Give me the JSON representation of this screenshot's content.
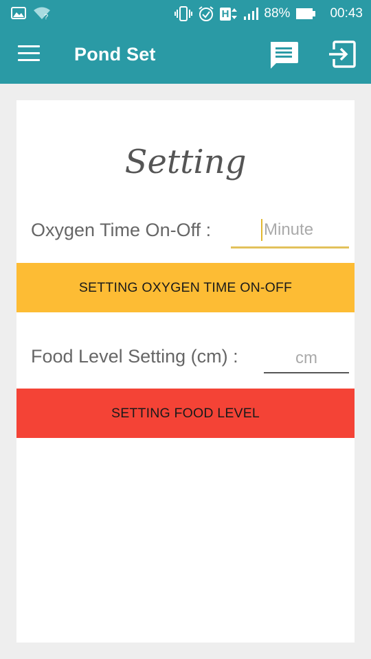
{
  "status_bar": {
    "battery": "88%",
    "time": "00:43",
    "network": "H",
    "icons": [
      "image-icon",
      "wifi-icon",
      "vibrate-icon",
      "alarm-icon",
      "network-h-icon",
      "signal-icon",
      "battery-icon"
    ]
  },
  "app_bar": {
    "title": "Pond Set",
    "icons": [
      "menu-icon",
      "chat-icon",
      "exit-icon"
    ]
  },
  "card": {
    "heading": "Setting",
    "oxygen": {
      "label": "Oxygen Time On-Off :",
      "placeholder": "Minute",
      "button": "SETTING OXYGEN TIME ON-OFF"
    },
    "food": {
      "label": "Food Level Setting (cm) :",
      "placeholder": "cm",
      "button": "SETTING FOOD LEVEL"
    }
  },
  "colors": {
    "primary": "#2a9aa5",
    "oxygen_button": "#fdbc34",
    "food_button": "#f44336",
    "background": "#eeeeee"
  }
}
